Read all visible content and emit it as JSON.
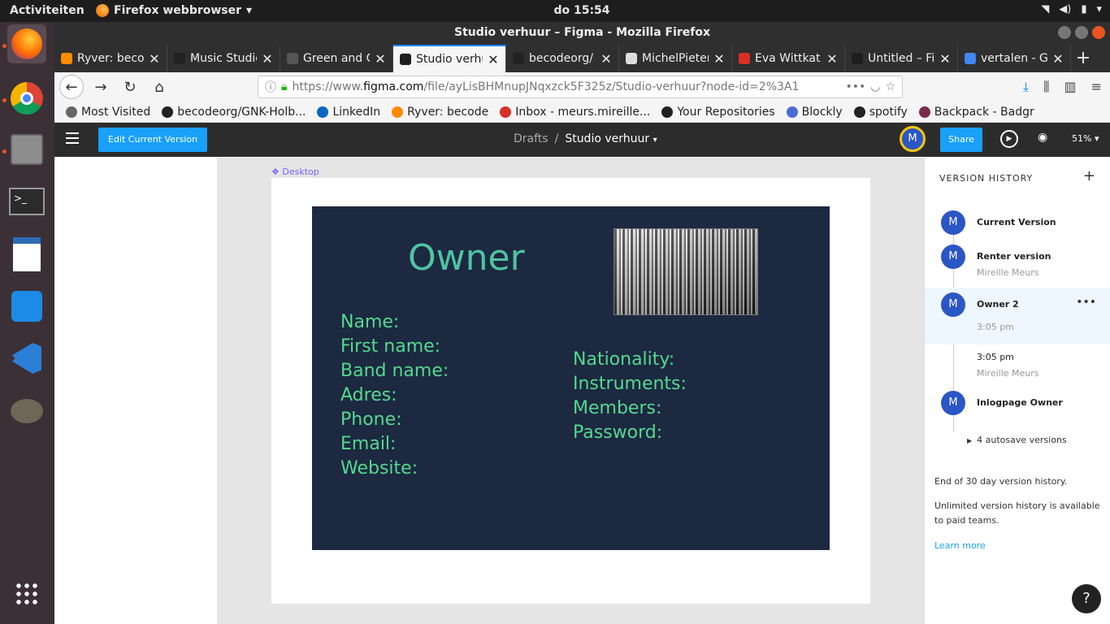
{
  "topbar": {
    "activities": "Activiteiten",
    "app_menu": "Firefox webbrowser",
    "clock": "do 15:54"
  },
  "window": {
    "title": "Studio verhuur – Figma - Mozilla Firefox"
  },
  "tabs": [
    {
      "label": "Ryver: becode",
      "color": "#ff8a00"
    },
    {
      "label": "Music Studio",
      "color": "#222222"
    },
    {
      "label": "Green and C",
      "color": "#555555"
    },
    {
      "label": "Studio verhuur",
      "color": "#1e1e1e"
    },
    {
      "label": "becodeorg/",
      "color": "#222222"
    },
    {
      "label": "MichelPieters.",
      "color": "#dddddd"
    },
    {
      "label": "Eva Wittkat",
      "color": "#d93025"
    },
    {
      "label": "Untitled – Fi",
      "color": "#1e1e1e"
    },
    {
      "label": "vertalen - Go",
      "color": "#4285f4"
    }
  ],
  "url": {
    "prefix": "https://www.",
    "domain": "figma.com",
    "path": "/file/ayLisBHMnupJNqxzck5F325z/Studio-verhuur?node-id=2%3A1"
  },
  "bookmarks": [
    {
      "label": "Most Visited",
      "color": "#666666"
    },
    {
      "label": "becodeorg/GNK-Holb...",
      "color": "#222222"
    },
    {
      "label": "LinkedIn",
      "color": "#0a66c2"
    },
    {
      "label": "Ryver: becode",
      "color": "#ff8a00"
    },
    {
      "label": "Inbox - meurs.mireille...",
      "color": "#d93025"
    },
    {
      "label": "Your Repositories",
      "color": "#222222"
    },
    {
      "label": "Blockly",
      "color": "#4a6cd4"
    },
    {
      "label": "spotify",
      "color": "#222222"
    },
    {
      "label": "Backpack - Badgr",
      "color": "#7a2b4a"
    }
  ],
  "figma": {
    "edit_btn": "Edit Current Version",
    "crumb_parent": "Drafts",
    "crumb_sep": "/",
    "crumb_current": "Studio verhuur",
    "avatar": "M",
    "share": "Share",
    "zoom": "51%"
  },
  "canvas": {
    "frame_label": "❖ Desktop",
    "title": "Owner",
    "fields_left": [
      "Name:",
      "First name:",
      "Band name:",
      "Adres:",
      "Phone:",
      "Email:",
      "Website:"
    ],
    "fields_right": [
      "Nationality:",
      "Instruments:",
      "Members:",
      "Password:"
    ]
  },
  "history": {
    "header": "VERSION HISTORY",
    "versions": [
      {
        "avatar": "M",
        "title": "Current Version"
      },
      {
        "avatar": "M",
        "title": "Renter version",
        "sub": "Mireille Meurs"
      },
      {
        "avatar": "M",
        "title": "Owner 2",
        "sub": "3:05 pm"
      },
      {
        "time": "3:05 pm",
        "sub": "Mireille Meurs"
      },
      {
        "avatar": "M",
        "title": "Inlogpage Owner"
      }
    ],
    "autosave": "4 autosave versions",
    "end_note": "End of 30 day version history.",
    "paid_note": "Unlimited version history is available to paid teams.",
    "learn_more": "Learn more",
    "help": "?"
  }
}
